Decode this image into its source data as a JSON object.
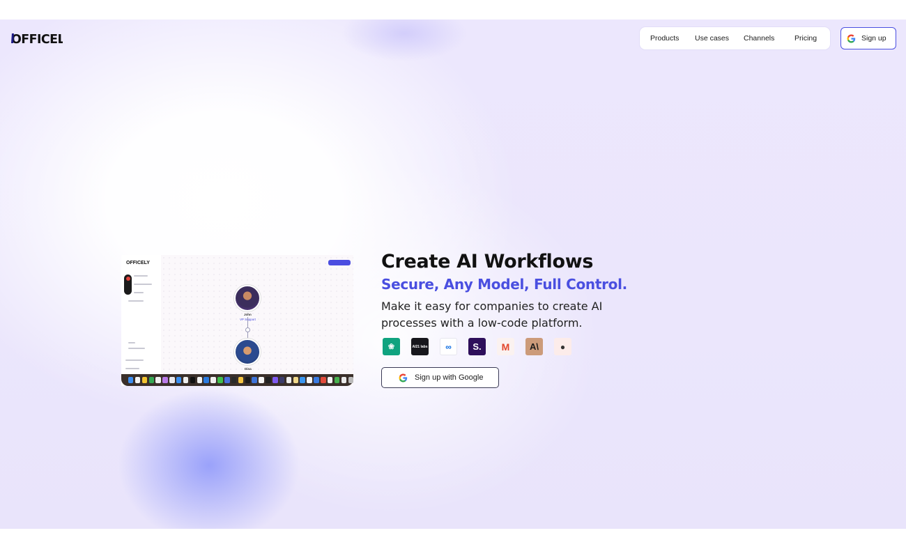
{
  "brand": {
    "logo_text": "OFFICELY",
    "accent_color": "#4a4fe0",
    "logo_color": "#1e1b86"
  },
  "nav": {
    "items": [
      {
        "label": "Products"
      },
      {
        "label": "Use cases"
      },
      {
        "label": "Channels"
      },
      {
        "label": "Pricing"
      }
    ],
    "signup_label": "Sign up",
    "signup_icon": "google-icon"
  },
  "hero": {
    "title": "Create AI Workflows",
    "subtitle": "Secure, Any Model, Full Control.",
    "description": "Make it easy for companies to create AI processes with a low-code platform.",
    "models": [
      {
        "name": "openai-icon",
        "glyph": "❀"
      },
      {
        "name": "ai21-icon",
        "glyph": "AI21 labs"
      },
      {
        "name": "meta-icon",
        "glyph": "∞"
      },
      {
        "name": "s-icon",
        "glyph": "S."
      },
      {
        "name": "mistral-icon",
        "glyph": "M"
      },
      {
        "name": "anthropic-icon",
        "glyph": "A\\"
      },
      {
        "name": "model-icon",
        "glyph": "●"
      }
    ],
    "cta_label": "Sign up with Google",
    "cta_icon": "google-icon"
  },
  "preview": {
    "logo_text": "OFFICELY",
    "node1_name": "John",
    "node1_role": "VP Support",
    "node2_name": "Dina"
  }
}
